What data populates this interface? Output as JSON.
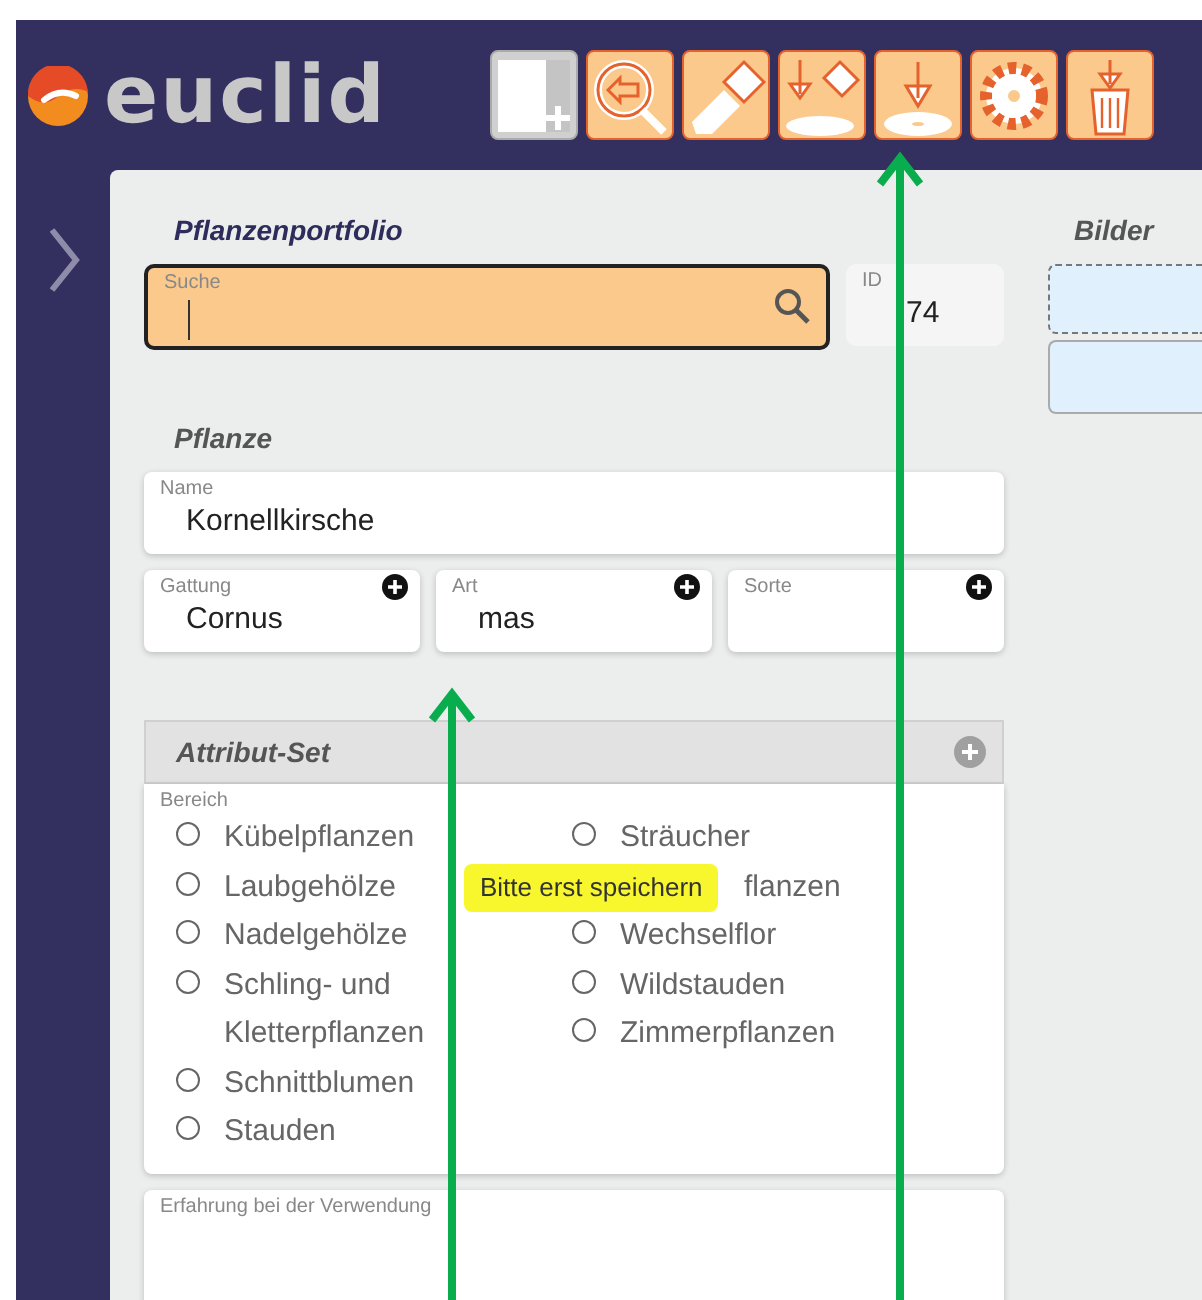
{
  "app": {
    "name": "euclid"
  },
  "toolbar": [
    {
      "kind": "new",
      "disabled": true
    },
    {
      "kind": "back-search",
      "disabled": false
    },
    {
      "kind": "eraser",
      "disabled": false
    },
    {
      "kind": "save-erase",
      "disabled": false
    },
    {
      "kind": "save",
      "disabled": false
    },
    {
      "kind": "settings",
      "disabled": false
    },
    {
      "kind": "delete",
      "disabled": false
    }
  ],
  "portfolio": {
    "title": "Pflanzenportfolio",
    "search": {
      "label": "Suche",
      "focused": true
    },
    "id": {
      "label": "ID",
      "value": "74"
    }
  },
  "images": {
    "title": "Bilder"
  },
  "plant": {
    "title": "Pflanze",
    "name": {
      "label": "Name",
      "value": "Kornellkirsche"
    },
    "fields": [
      {
        "label": "Gattung",
        "value": "Cornus",
        "addable": true
      },
      {
        "label": "Art",
        "value": "mas",
        "addable": true
      },
      {
        "label": "Sorte",
        "addable": true
      }
    ]
  },
  "attribute_set": {
    "title": "Attribut-Set",
    "group_label": "Bereich",
    "left": [
      {
        "label": "Kübelpflanzen",
        "selected": false
      },
      {
        "label": "Laubgehölze",
        "selected": false
      },
      {
        "label": "Nadelgehölze",
        "selected": false
      },
      {
        "label": "Schling- und Kletterpflanzen",
        "selected": false
      },
      {
        "label": "Schnittblumen",
        "selected": false
      },
      {
        "label": "Stauden",
        "selected": false
      }
    ],
    "right": [
      {
        "label": "Sträucher",
        "selected": false
      },
      {
        "label": "flanzen"
      },
      {
        "label": "Wechselflor",
        "selected": false
      },
      {
        "label": "Wildstauden",
        "selected": false
      },
      {
        "label": "Zimmerpflanzen",
        "selected": false
      }
    ]
  },
  "tooltip": {
    "text": "Bitte erst speichern"
  },
  "experience": {
    "label": "Erfahrung bei der Verwendung"
  }
}
